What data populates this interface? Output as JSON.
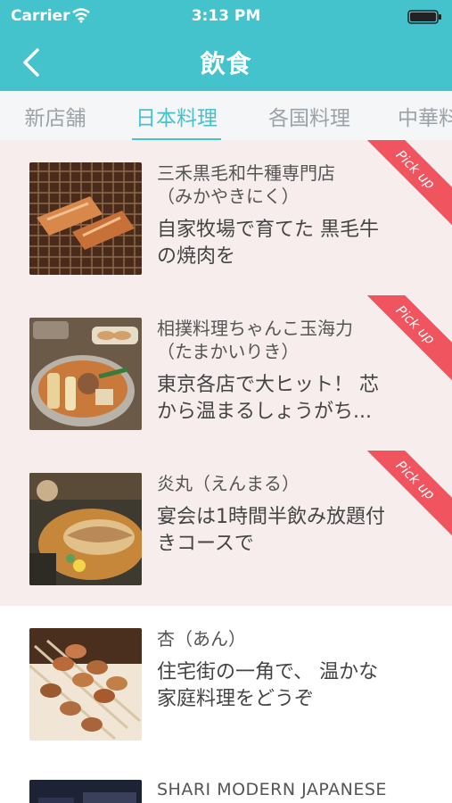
{
  "status": {
    "carrier": "Carrier",
    "time": "3:13 PM"
  },
  "nav": {
    "title": "飲食"
  },
  "tabs": [
    {
      "label": "新店舗"
    },
    {
      "label": "日本料理"
    },
    {
      "label": "各国料理"
    },
    {
      "label": "中華料"
    }
  ],
  "list": {
    "items": [
      {
        "name": "三禾黒毛和牛種専門店\n（みかやきにく）",
        "desc": "自家牧場で育てた 黒毛牛\nの焼肉を",
        "pick": "Pick up"
      },
      {
        "name": "相撲料理ちゃんこ玉海力\n（たまかいりき）",
        "desc": "東京各店で大ヒット！ 芯\nから温まるしょうがち...",
        "pick": "Pick up"
      },
      {
        "name": "炎丸（えんまる）",
        "desc": "宴会は1時間半飲み放題付\nきコースで",
        "pick": "Pick up"
      },
      {
        "name": "杏（あん）",
        "desc": "住宅街の一角で、 温かな\n家庭料理をどうぞ"
      },
      {
        "name": "SHARI MODERN JAPANESE"
      }
    ]
  }
}
